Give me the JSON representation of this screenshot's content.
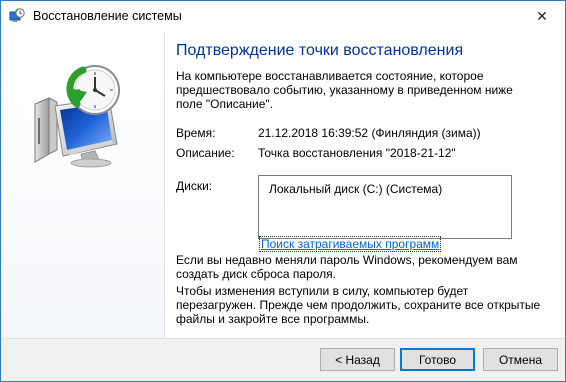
{
  "window": {
    "title": "Восстановление системы",
    "close_glyph": "✕"
  },
  "main": {
    "heading": "Подтверждение точки восстановления",
    "intro": "На компьютере восстанавливается состояние, которое предшествовало событию, указанному в приведенном ниже поле \"Описание\".",
    "time_label": "Время:",
    "time_value": "21.12.2018 16:39:52 (Финляндия (зима))",
    "description_label": "Описание:",
    "description_value": "Точка восстановления \"2018-21-12\"",
    "disks_label": "Диски:",
    "disks": [
      "Локальный диск (C:) (Система)"
    ],
    "affected_link": "Поиск затрагиваемых программ",
    "password_note": "Если вы недавно меняли пароль Windows, рекомендуем вам создать диск сброса пароля.",
    "restart_note": "Чтобы изменения вступили в силу, компьютер будет перезагружен. Прежде чем продолжить, сохраните все открытые файлы и закройте все программы."
  },
  "buttons": {
    "back": "< Назад",
    "finish": "Готово",
    "cancel": "Отмена"
  },
  "colors": {
    "heading": "#003399",
    "link": "#0066cc",
    "accent": "#0078d7"
  }
}
